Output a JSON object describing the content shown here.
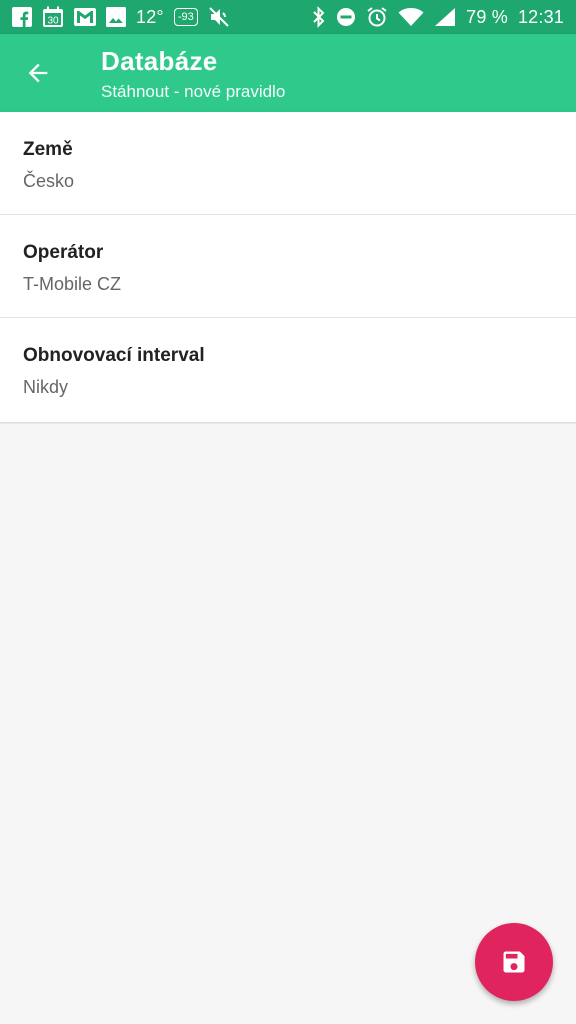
{
  "status_bar": {
    "left_icons": [
      "facebook-icon",
      "calendar-icon",
      "gmail-icon",
      "image-icon"
    ],
    "calendar_day": "30",
    "temperature": "12°",
    "signal_badge": "-93",
    "right_icons": [
      "bluetooth-icon",
      "do-not-disturb-icon",
      "alarm-icon",
      "wifi-icon",
      "cell-signal-icon"
    ],
    "battery": "79 %",
    "time": "12:31",
    "color": "#1ea86f"
  },
  "app_bar": {
    "title": "Databáze",
    "subtitle": "Stáhnout - nové pravidlo",
    "back_icon": "arrow-back-icon",
    "color": "#2ec98b"
  },
  "settings": {
    "items": [
      {
        "title": "Země",
        "value": "Česko"
      },
      {
        "title": "Operátor",
        "value": "T-Mobile CZ"
      },
      {
        "title": "Obnovovací interval",
        "value": "Nikdy"
      }
    ]
  },
  "fab": {
    "icon": "save-icon",
    "color": "#e0245e"
  }
}
